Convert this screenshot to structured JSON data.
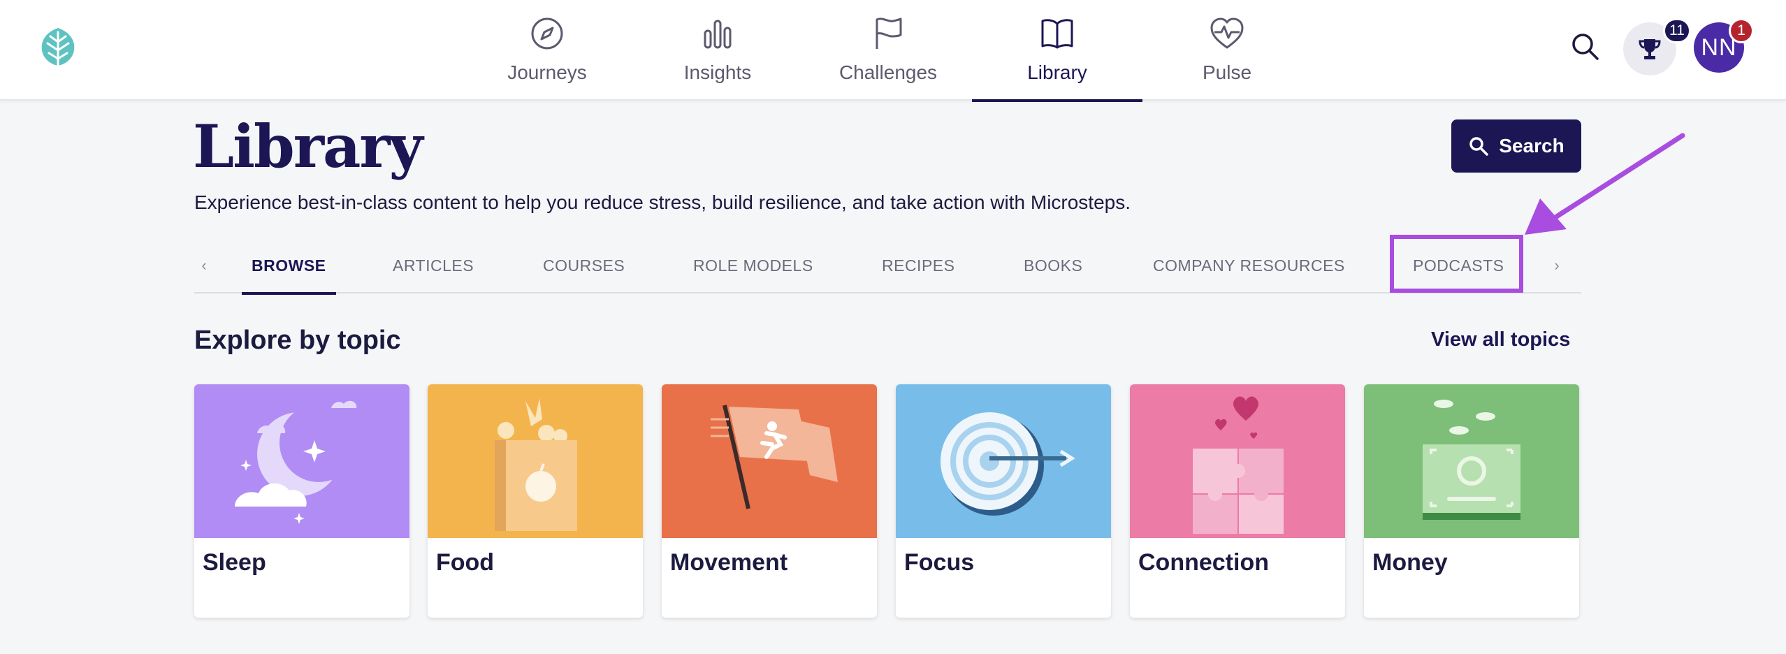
{
  "nav": {
    "items": [
      {
        "label": "Journeys",
        "icon": "compass-icon"
      },
      {
        "label": "Insights",
        "icon": "bar-chart-icon"
      },
      {
        "label": "Challenges",
        "icon": "flag-icon"
      },
      {
        "label": "Library",
        "icon": "book-icon",
        "active": true
      },
      {
        "label": "Pulse",
        "icon": "heart-pulse-icon"
      }
    ],
    "trophy_count": "11",
    "avatar_initials": "NN",
    "avatar_badge": "1"
  },
  "page": {
    "title": "Library",
    "subtitle": "Experience best-in-class content to help you reduce stress, build resilience, and take action with Microsteps.",
    "search_label": "Search"
  },
  "tabs": [
    {
      "label": "BROWSE",
      "active": true
    },
    {
      "label": "ARTICLES"
    },
    {
      "label": "COURSES"
    },
    {
      "label": "ROLE MODELS"
    },
    {
      "label": "RECIPES"
    },
    {
      "label": "BOOKS"
    },
    {
      "label": "COMPANY RESOURCES"
    },
    {
      "label": "PODCASTS",
      "highlighted": true
    }
  ],
  "explore": {
    "title": "Explore by topic",
    "view_all": "View all topics",
    "topics": [
      {
        "label": "Sleep",
        "color": "#b18cf5"
      },
      {
        "label": "Food",
        "color": "#f4b44d"
      },
      {
        "label": "Movement",
        "color": "#e8714a"
      },
      {
        "label": "Focus",
        "color": "#78bde9"
      },
      {
        "label": "Connection",
        "color": "#ec7ba6"
      },
      {
        "label": "Money",
        "color": "#7dbf78"
      }
    ]
  },
  "colors": {
    "brand_navy": "#1c1654",
    "highlight_purple": "#a84de0",
    "avatar_purple": "#4b2aa6",
    "badge_red": "#b5242d"
  }
}
